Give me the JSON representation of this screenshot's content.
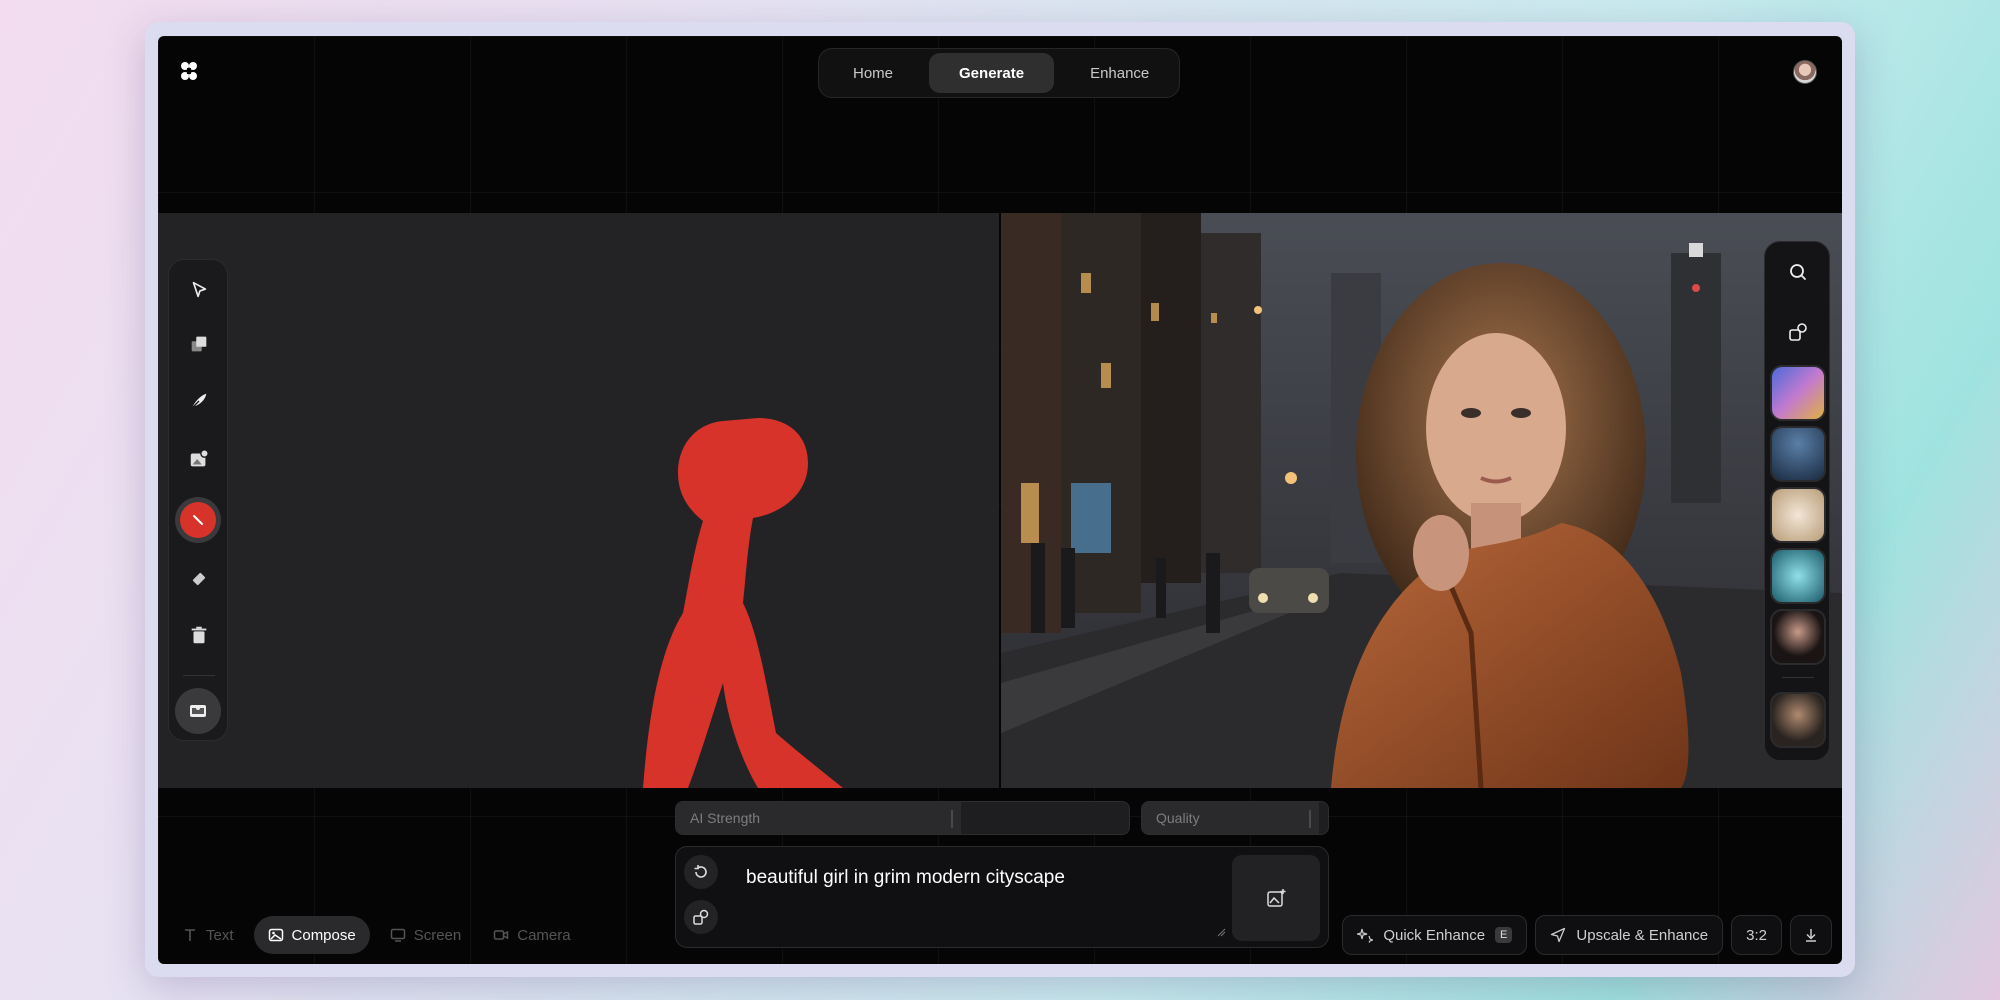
{
  "nav": {
    "tabs": [
      {
        "label": "Home",
        "active": false
      },
      {
        "label": "Generate",
        "active": true
      },
      {
        "label": "Enhance",
        "active": false
      }
    ]
  },
  "left_toolbar": {
    "tools": [
      "select-arrow-icon",
      "layers-icon",
      "feather-brush-icon",
      "image-add-icon",
      "color-picker",
      "eraser-icon",
      "trash-icon",
      "image-capture-icon"
    ],
    "active_color": "#d7332a"
  },
  "controls": {
    "ai_strength_label": "AI Strength",
    "ai_strength_value": 0.63,
    "quality_label": "Quality",
    "quality_value": 0.95
  },
  "prompt": {
    "text": "beautiful girl in grim modern cityscape"
  },
  "modes": [
    {
      "label": "Text",
      "icon": "text-icon",
      "active": false
    },
    {
      "label": "Compose",
      "icon": "image-icon",
      "active": true
    },
    {
      "label": "Screen",
      "icon": "monitor-icon",
      "active": false
    },
    {
      "label": "Camera",
      "icon": "camera-icon",
      "active": false
    }
  ],
  "actions": {
    "quick_enhance": "Quick Enhance",
    "quick_enhance_shortcut": "E",
    "upscale_enhance": "Upscale & Enhance",
    "aspect_ratio": "3:2"
  },
  "right_rail": {
    "buttons": [
      "search-icon",
      "shapes-icon"
    ],
    "thumbnails": [
      "thumb-abstract-art",
      "thumb-night-sky",
      "thumb-white-flower",
      "thumb-teal-fractal",
      "thumb-dark-portrait",
      "thumb-warrior-portrait"
    ]
  }
}
